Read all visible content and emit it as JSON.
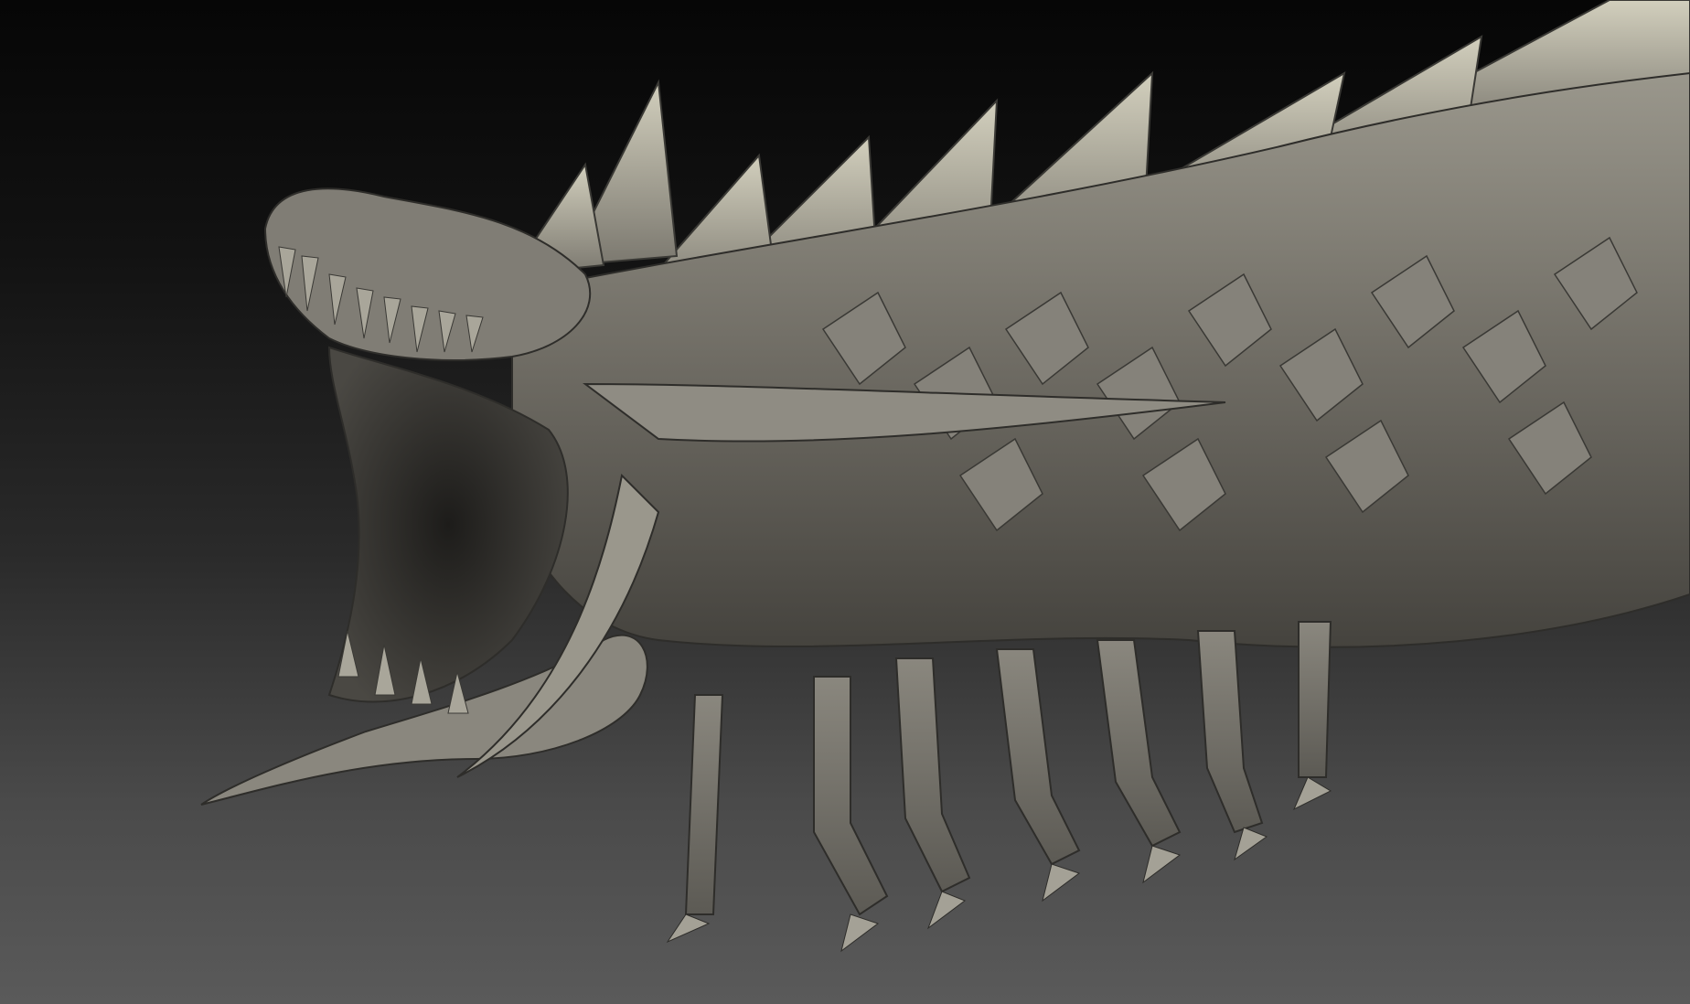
{
  "scene": {
    "subject": "creature-sculpt",
    "background": {
      "top_color": "#060606",
      "bottom_color": "#5a5a5a"
    },
    "material": {
      "base_color": "#7d7a72",
      "highlight_color": "#c9c6b4",
      "shadow_color": "#2e2d2a"
    }
  }
}
